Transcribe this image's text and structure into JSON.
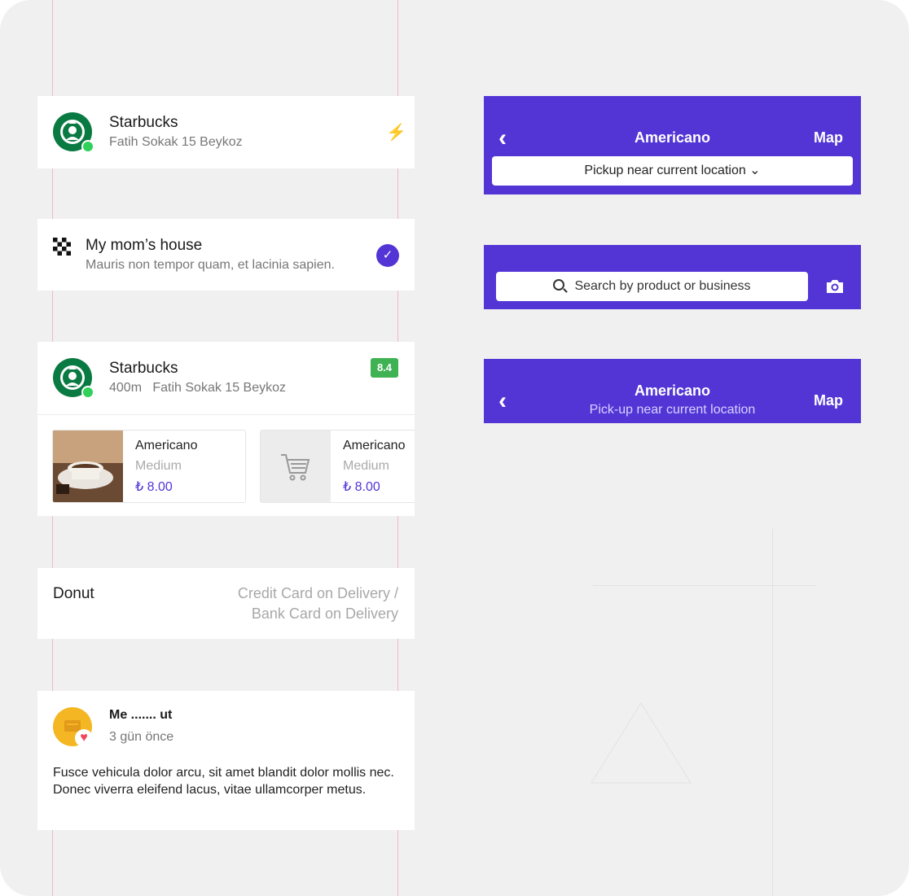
{
  "store_row": {
    "name": "Starbucks",
    "address": "Fatih Sokak 15 Beykoz",
    "bolt_icon": "⚡"
  },
  "address_row": {
    "title": "My mom’s house",
    "description": "Mauris non tempor quam, et lacinia sapien.",
    "check_icon": "✓"
  },
  "store_products": {
    "name": "Starbucks",
    "distance_address": "400m   Fatih Sokak 15 Beykoz",
    "rating": "8.4",
    "products": [
      {
        "name": "Americano",
        "size": "Medium",
        "price": "₺ 8.00"
      },
      {
        "name": "Americano",
        "size": "Medium",
        "price": "₺ 8.00"
      }
    ]
  },
  "payment_row": {
    "item": "Donut",
    "method_line1": "Credit Card on Delivery /",
    "method_line2": "Bank Card on Delivery"
  },
  "review": {
    "author": "Me ....... ut",
    "time": "3 gün önce",
    "heart_icon": "♥",
    "text": "Fusce vehicula dolor arcu, sit amet blandit dolor mollis nec. Donec viverra eleifend lacus, vitae ullamcorper metus."
  },
  "app_bar_pickup": {
    "back_icon": "‹",
    "title": "Americano",
    "map_label": "Map",
    "pickup_button": "Pickup near current location ⌄"
  },
  "app_bar_search": {
    "placeholder": "Search by product or business"
  },
  "app_bar_subtitle": {
    "back_icon": "‹",
    "title": "Americano",
    "subtitle": "Pick-up near current location",
    "map_label": "Map"
  },
  "colors": {
    "brand_purple": "#5335d6",
    "rating_green": "#3fb253",
    "online_green": "#2fd159",
    "price_purple": "#5335d6"
  }
}
